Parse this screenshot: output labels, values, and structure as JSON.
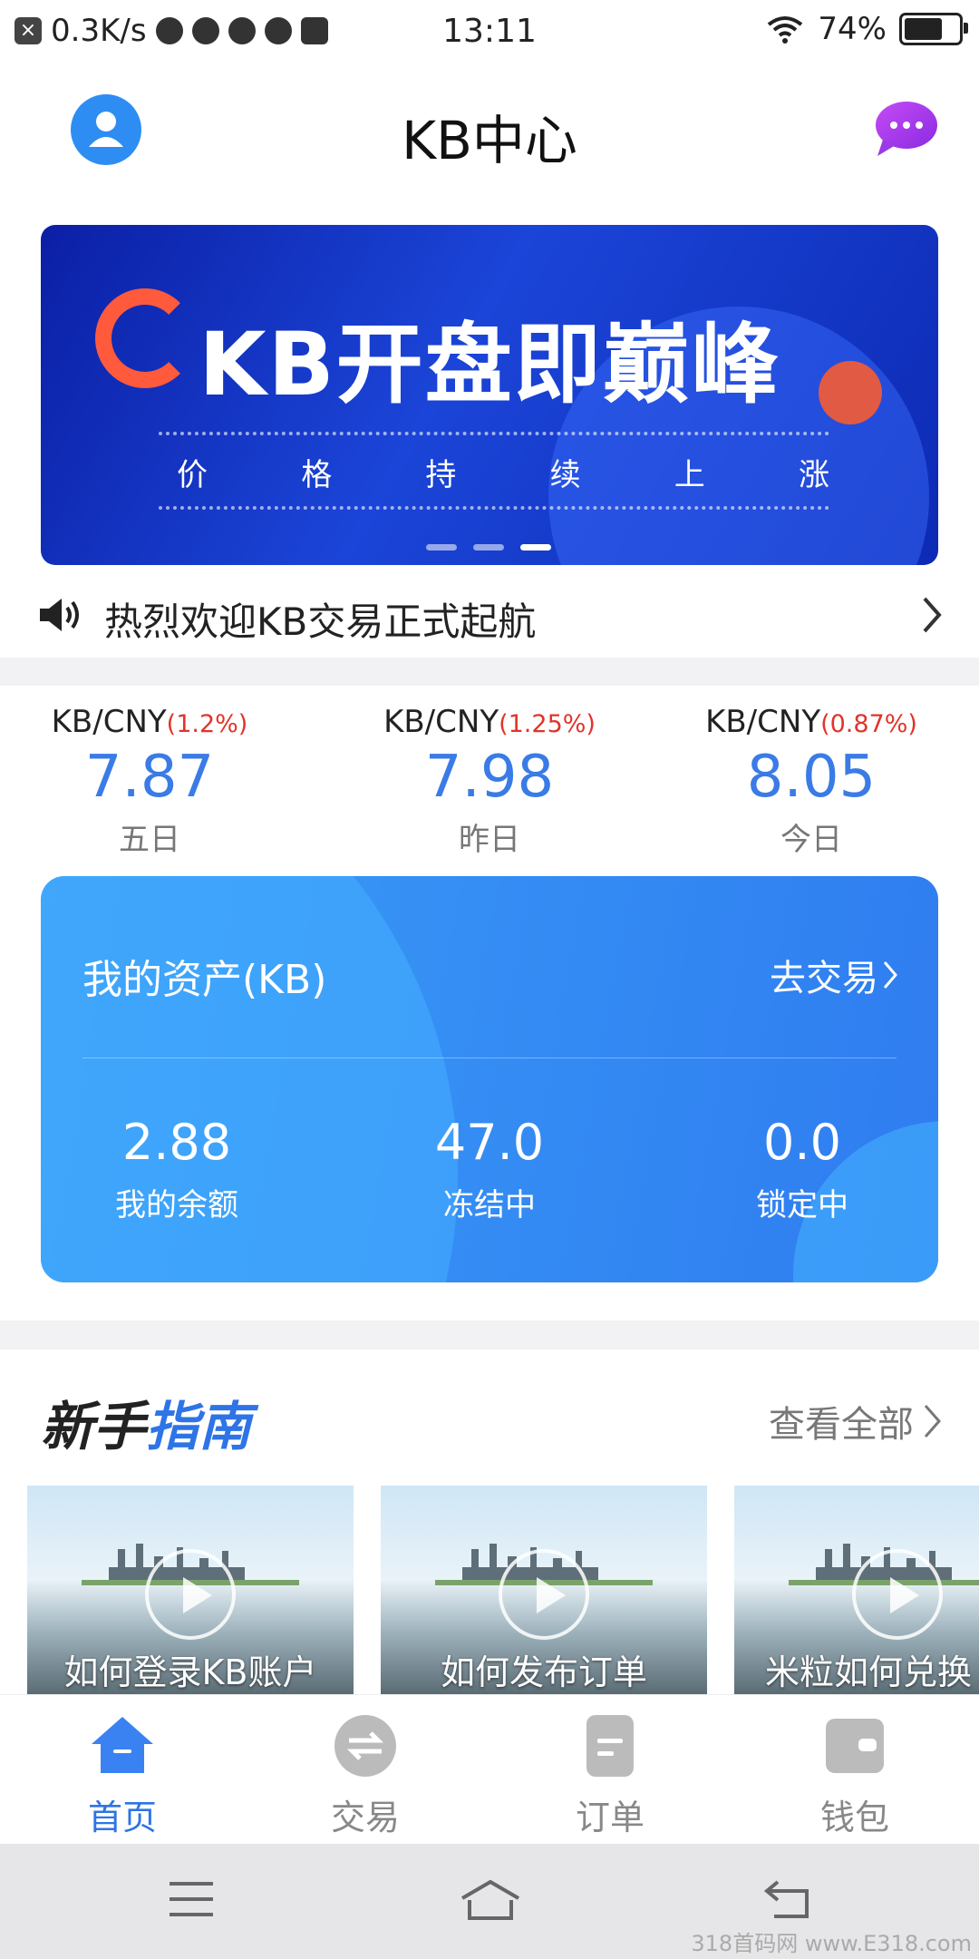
{
  "status_bar": {
    "speed": "0.3K/s",
    "time": "13:11",
    "battery": "74%",
    "battery_level": 0.74
  },
  "header": {
    "title": "KB中心"
  },
  "banner": {
    "headline": "KB开盘即巅峰",
    "subtitle_chars": [
      "价",
      "格",
      "持",
      "续",
      "上",
      "涨"
    ],
    "page_count": 3,
    "active_page": 3
  },
  "notice": {
    "text": "热烈欢迎KB交易正式起航"
  },
  "prices": [
    {
      "pair": "KB/CNY",
      "change": "(1.2%)",
      "price": "7.87",
      "label": "五日"
    },
    {
      "pair": "KB/CNY",
      "change": "(1.25%)",
      "price": "7.98",
      "label": "昨日"
    },
    {
      "pair": "KB/CNY",
      "change": "(0.87%)",
      "price": "8.05",
      "label": "今日"
    }
  ],
  "assets": {
    "title": "我的资产(KB)",
    "trade_link": "去交易",
    "items": [
      {
        "value": "2.88",
        "label": "我的余额"
      },
      {
        "value": "47.0",
        "label": "冻结中"
      },
      {
        "value": "0.0",
        "label": "锁定中"
      }
    ]
  },
  "guide": {
    "title_a": "新手",
    "title_b": "指南",
    "more": "查看全部",
    "videos": [
      {
        "caption": "如何登录KB账户"
      },
      {
        "caption": "如何发布订单"
      },
      {
        "caption": "米粒如何兑换"
      }
    ]
  },
  "tabs": [
    {
      "label": "首页",
      "icon": "home-icon",
      "active": true
    },
    {
      "label": "交易",
      "icon": "exchange-icon",
      "active": false
    },
    {
      "label": "订单",
      "icon": "order-icon",
      "active": false
    },
    {
      "label": "钱包",
      "icon": "wallet-icon",
      "active": false
    }
  ],
  "colors": {
    "accent": "#2e74e6",
    "price_blue": "#3a7be6",
    "change_red": "#e0342a"
  },
  "watermark": "318首码网 www.E318.com"
}
